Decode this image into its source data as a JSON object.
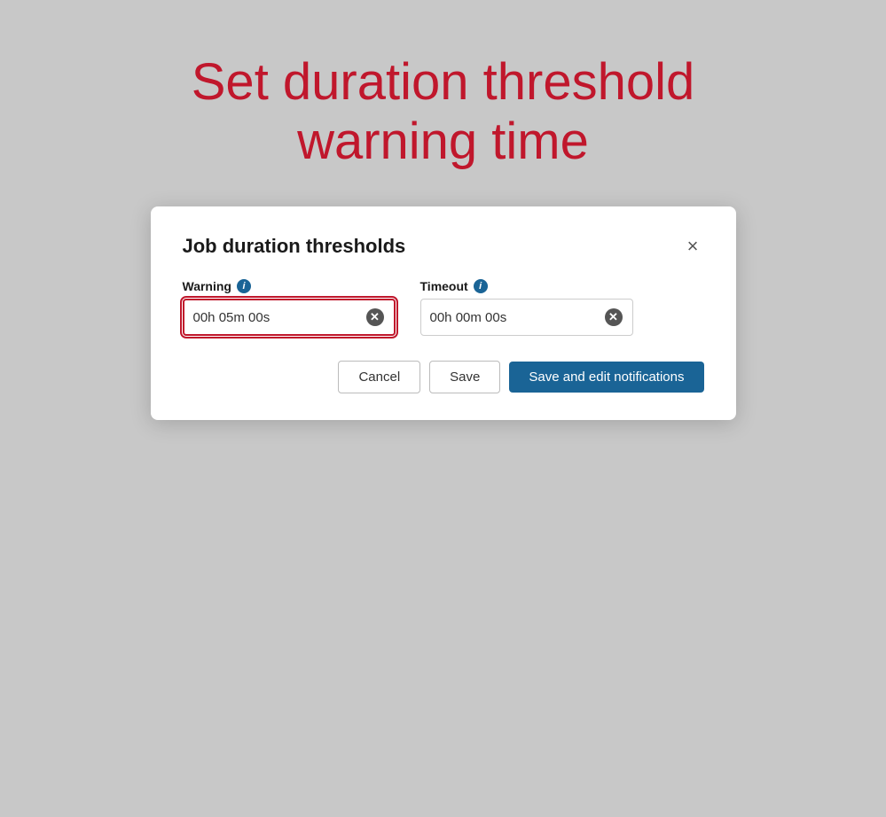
{
  "page": {
    "title_line1": "Set duration threshold",
    "title_line2": "warning time",
    "title_color": "#c0172c"
  },
  "dialog": {
    "title": "Job duration thresholds",
    "close_label": "×",
    "warning_field": {
      "label": "Warning",
      "value": "00h 05m 00s",
      "info_icon": "i",
      "active": true
    },
    "timeout_field": {
      "label": "Timeout",
      "value": "00h 00m 00s",
      "info_icon": "i",
      "active": false
    },
    "cancel_label": "Cancel",
    "save_label": "Save",
    "save_edit_label": "Save and edit notifications"
  }
}
